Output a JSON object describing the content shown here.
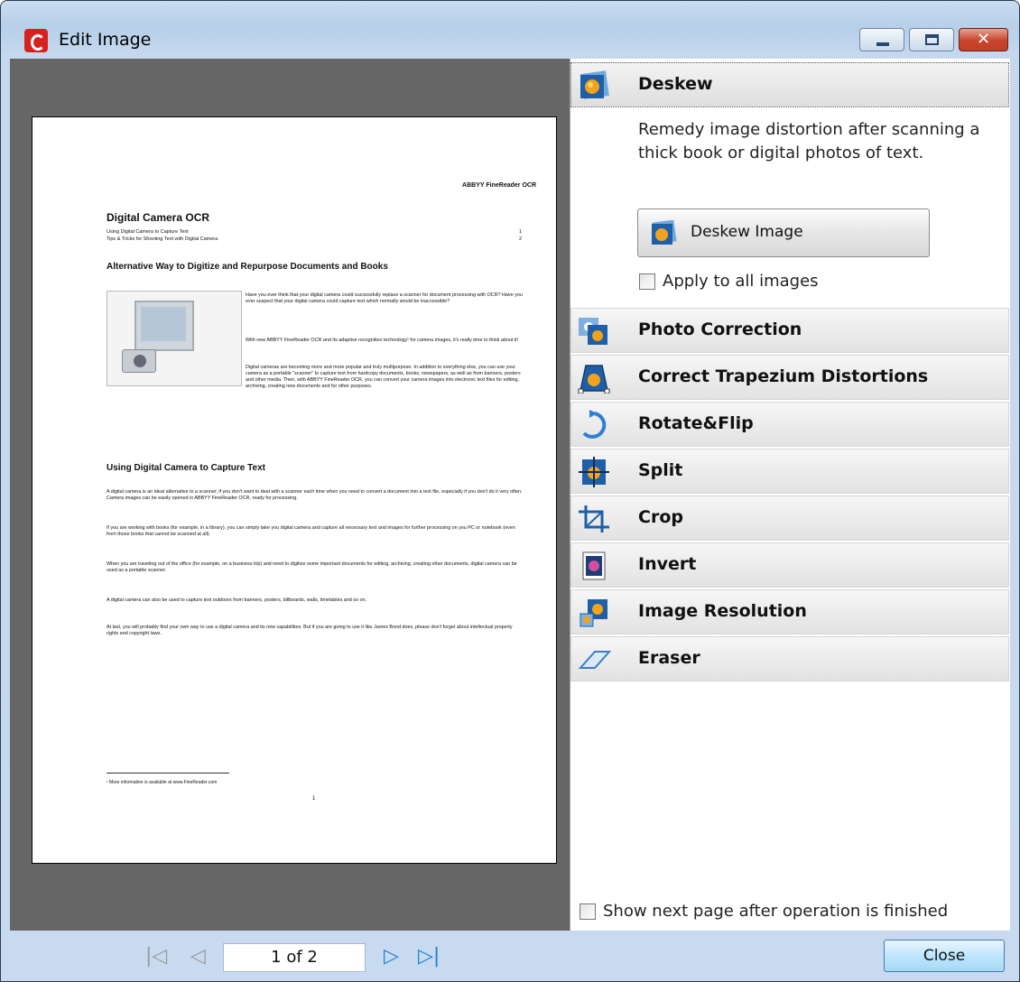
{
  "window": {
    "title": "Edit Image",
    "close_glyph": "✕"
  },
  "document": {
    "brand": "ABBYY FineReader OCR",
    "title": "Digital Camera OCR",
    "toc": [
      {
        "text": "Using Digital Camera to Capture Text",
        "page": "1"
      },
      {
        "text": "Tips & Tricks for Shooting Text with Digital Camera",
        "page": "2"
      }
    ],
    "heading1": "Alternative Way to Digitize and Repurpose Documents and Books",
    "intro_p1": "Have you ever think that your digital camera could successfully replace a scanner for document processing with OCR? Have you ever suspect that your digital camera could capture text which normally would be inaccessible?",
    "intro_p2": "With new ABBYY FineReader OCR and its adaptive recognition technology¹ for camera images, it's really time to think about it!",
    "intro_p3": "Digital cameras are becoming more and more popular and truly multipurpose. In addition to everything else, you can use your camera as a portable \"scanner\" to capture text from hardcopy documents, books, newspapers, as well as from banners, posters and other media. Then, with ABBYY FineReader OCR, you can convert your camera images into electronic text files for editing, archiving, creating new documents and for other purposes.",
    "heading2": "Using Digital Camera to Capture Text",
    "body_p1": "A digital camera is an ideal alternative to a scanner, if you don't want to deal with a scanner each time when you need to convert a document into a text file, especially if you don't do it very often. Camera images can be easily opened in ABBYY FineReader OCR, ready for processing.",
    "body_p2": "If you are working with books (for example, in a library), you can simply take you digital camera and capture all necessary text and images for further processing on you PC or notebook (even from those books that cannot be scanned at all).",
    "body_p3": "When you are traveling out of the office (for example, on a business trip) and need to digitize some important documents for editing, archiving, creating other documents, digital camera can be used as a portable scanner.",
    "body_p4": "A digital camera can also be used to capture text outdoors from banners, posters, billboards, walls, timetables and so on.",
    "body_p5": "At last, you will probably find your own way to use a digital camera and its new capabilities. But if you are going to use it like James Bond does, please don't forget about intellectual property rights and copyright laws.",
    "footnote": "¹ More information is available at www.FineReader.com",
    "page_number": "1"
  },
  "panel": {
    "sections": [
      {
        "label": "Deskew",
        "icon": "deskew-icon",
        "active": true
      },
      {
        "label": "Photo Correction",
        "icon": "photo-correction-icon"
      },
      {
        "label": "Correct Trapezium Distortions",
        "icon": "trapezium-icon"
      },
      {
        "label": "Rotate&Flip",
        "icon": "rotate-icon"
      },
      {
        "label": "Split",
        "icon": "split-icon"
      },
      {
        "label": "Crop",
        "icon": "crop-icon"
      },
      {
        "label": "Invert",
        "icon": "invert-icon"
      },
      {
        "label": "Image Resolution",
        "icon": "resolution-icon"
      },
      {
        "label": "Eraser",
        "icon": "eraser-icon"
      }
    ],
    "deskew_description": "Remedy image distortion after scanning a thick book or digital photos of text.",
    "deskew_button": "Deskew Image",
    "apply_all_label": "Apply to all images",
    "show_next_label": "Show next page after operation is finished"
  },
  "navigation": {
    "page_indicator": "1 of 2",
    "close_label": "Close"
  },
  "colors": {
    "accent_blue": "#1e7fd8",
    "preview_bg": "#666666",
    "close_red": "#c6452c"
  }
}
